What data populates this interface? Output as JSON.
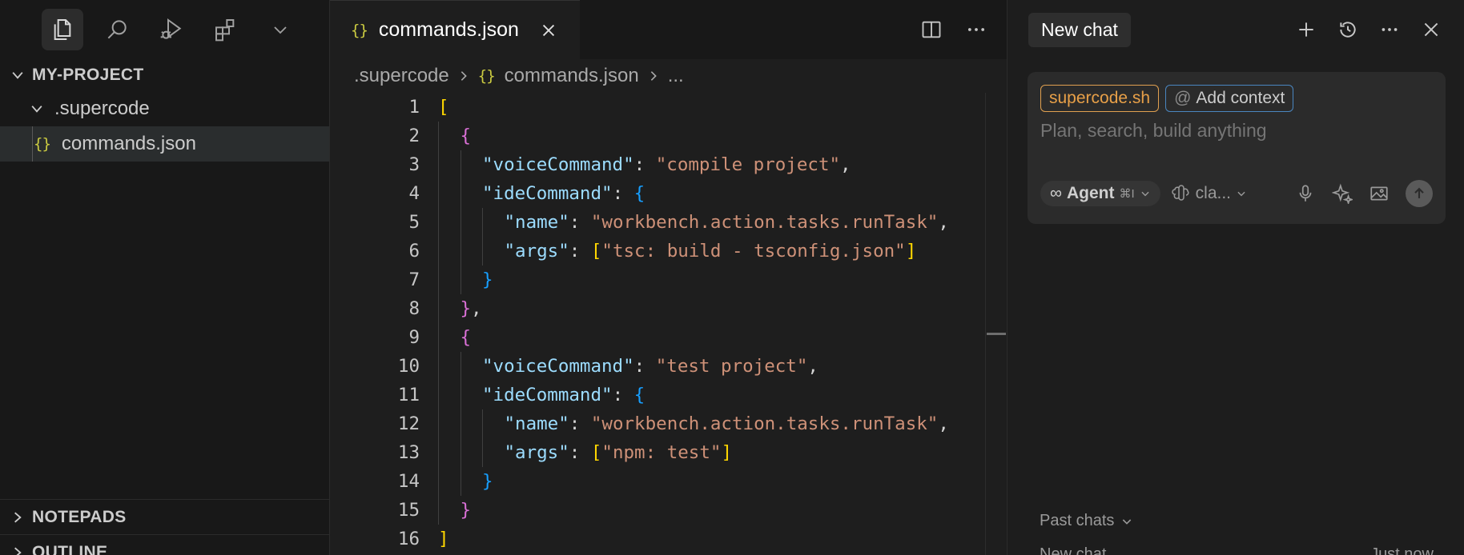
{
  "activity_bar": {
    "icons": [
      "explorer-icon",
      "search-icon",
      "run-debug-icon",
      "extensions-icon",
      "chevron-down-icon"
    ]
  },
  "explorer": {
    "project_title": "MY-PROJECT",
    "folder": ".supercode",
    "file": "commands.json",
    "file_icon": "{}",
    "bottom_sections": [
      "NOTEPADS",
      "OUTLINE"
    ]
  },
  "editor": {
    "tab_label": "commands.json",
    "tab_icon": "{}",
    "breadcrumb": {
      "folder": ".supercode",
      "file": "commands.json",
      "tail": "..."
    },
    "code_lines": [
      [
        {
          "t": "[",
          "c": "bracket"
        }
      ],
      [
        {
          "t": "{",
          "c": "brace2"
        }
      ],
      [
        {
          "t": "\"voiceCommand\"",
          "c": "key"
        },
        {
          "t": ": ",
          "c": "punc"
        },
        {
          "t": "\"compile project\"",
          "c": "str"
        },
        {
          "t": ",",
          "c": "punc"
        }
      ],
      [
        {
          "t": "\"ideCommand\"",
          "c": "key"
        },
        {
          "t": ": ",
          "c": "punc"
        },
        {
          "t": "{",
          "c": "brace3"
        }
      ],
      [
        {
          "t": "\"name\"",
          "c": "key"
        },
        {
          "t": ": ",
          "c": "punc"
        },
        {
          "t": "\"workbench.action.tasks.runTask\"",
          "c": "str"
        },
        {
          "t": ",",
          "c": "punc"
        }
      ],
      [
        {
          "t": "\"args\"",
          "c": "key"
        },
        {
          "t": ": ",
          "c": "punc"
        },
        {
          "t": "[",
          "c": "bracket"
        },
        {
          "t": "\"tsc: build - tsconfig.json\"",
          "c": "str"
        },
        {
          "t": "]",
          "c": "bracket"
        }
      ],
      [
        {
          "t": "}",
          "c": "brace3"
        }
      ],
      [
        {
          "t": "}",
          "c": "brace2"
        },
        {
          "t": ",",
          "c": "punc"
        }
      ],
      [
        {
          "t": "{",
          "c": "brace2"
        }
      ],
      [
        {
          "t": "\"voiceCommand\"",
          "c": "key"
        },
        {
          "t": ": ",
          "c": "punc"
        },
        {
          "t": "\"test project\"",
          "c": "str"
        },
        {
          "t": ",",
          "c": "punc"
        }
      ],
      [
        {
          "t": "\"ideCommand\"",
          "c": "key"
        },
        {
          "t": ": ",
          "c": "punc"
        },
        {
          "t": "{",
          "c": "brace3"
        }
      ],
      [
        {
          "t": "\"name\"",
          "c": "key"
        },
        {
          "t": ": ",
          "c": "punc"
        },
        {
          "t": "\"workbench.action.tasks.runTask\"",
          "c": "str"
        },
        {
          "t": ",",
          "c": "punc"
        }
      ],
      [
        {
          "t": "\"args\"",
          "c": "key"
        },
        {
          "t": ": ",
          "c": "punc"
        },
        {
          "t": "[",
          "c": "bracket"
        },
        {
          "t": "\"npm: test\"",
          "c": "str"
        },
        {
          "t": "]",
          "c": "bracket"
        }
      ],
      [
        {
          "t": "}",
          "c": "brace3"
        }
      ],
      [
        {
          "t": "}",
          "c": "brace2"
        }
      ],
      [
        {
          "t": "]",
          "c": "bracket"
        }
      ]
    ],
    "indent_levels": [
      0,
      1,
      2,
      2,
      3,
      3,
      2,
      1,
      1,
      2,
      2,
      3,
      3,
      2,
      1,
      0
    ]
  },
  "chat": {
    "title": "New chat",
    "header_icons": [
      "plus-icon",
      "history-icon",
      "more-icon",
      "close-icon"
    ],
    "chip_supercode": "supercode.sh",
    "chip_context_at": "@",
    "chip_context": "Add context",
    "placeholder": "Plan, search, build anything",
    "agent_symbol": "∞",
    "agent_label": "Agent",
    "agent_shortcut": "⌘I",
    "model_label": "cla...",
    "past_chats_label": "Past chats",
    "past_chat_item": "New chat",
    "past_chat_time": "Just now"
  },
  "colors": {
    "bracket": "#ffd700",
    "brace2": "#da70d6",
    "brace3": "#179fff",
    "key": "#9cdcfe",
    "str": "#ce9178",
    "json_icon": "#cbcb41"
  }
}
